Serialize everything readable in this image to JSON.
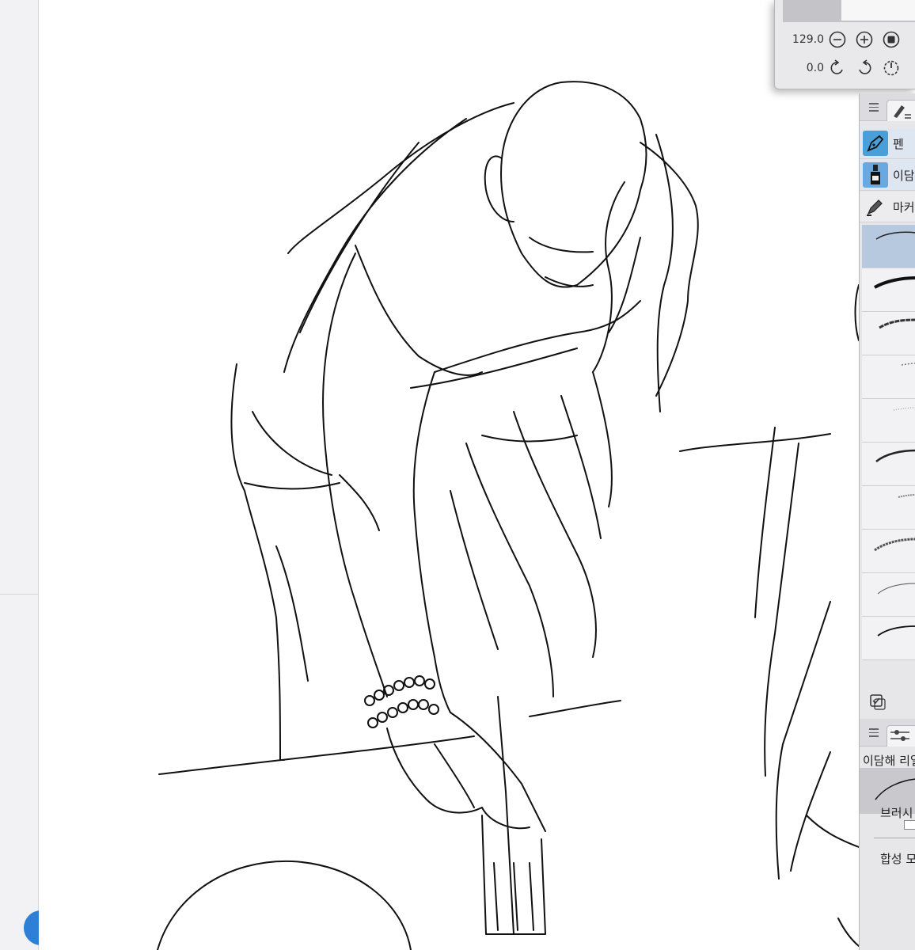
{
  "navigator": {
    "zoom_value": "129.0",
    "rotation_value": "0.0"
  },
  "tools": [
    {
      "label": "펜",
      "icon": "pen-nib-icon"
    },
    {
      "label": "이담",
      "icon": "ink-bottle-icon"
    },
    {
      "label": "마커",
      "icon": "marker-icon"
    }
  ],
  "brushes": [
    {
      "name": "brush-1",
      "selected": true
    },
    {
      "name": "brush-2"
    },
    {
      "name": "brush-3"
    },
    {
      "name": "brush-4"
    },
    {
      "name": "brush-5"
    },
    {
      "name": "brush-6"
    },
    {
      "name": "brush-7"
    },
    {
      "name": "brush-8"
    },
    {
      "name": "brush-9"
    },
    {
      "name": "brush-10"
    }
  ],
  "tool_property": {
    "subtool_name": "이담해 리얼",
    "brush_size_label": "브러시",
    "blend_mode_label": "합성 모"
  },
  "colors": {
    "panel_bg": "#e7e7ea",
    "selected_brush": "#b7c9df",
    "accent_blue": "#2e7fd6"
  }
}
